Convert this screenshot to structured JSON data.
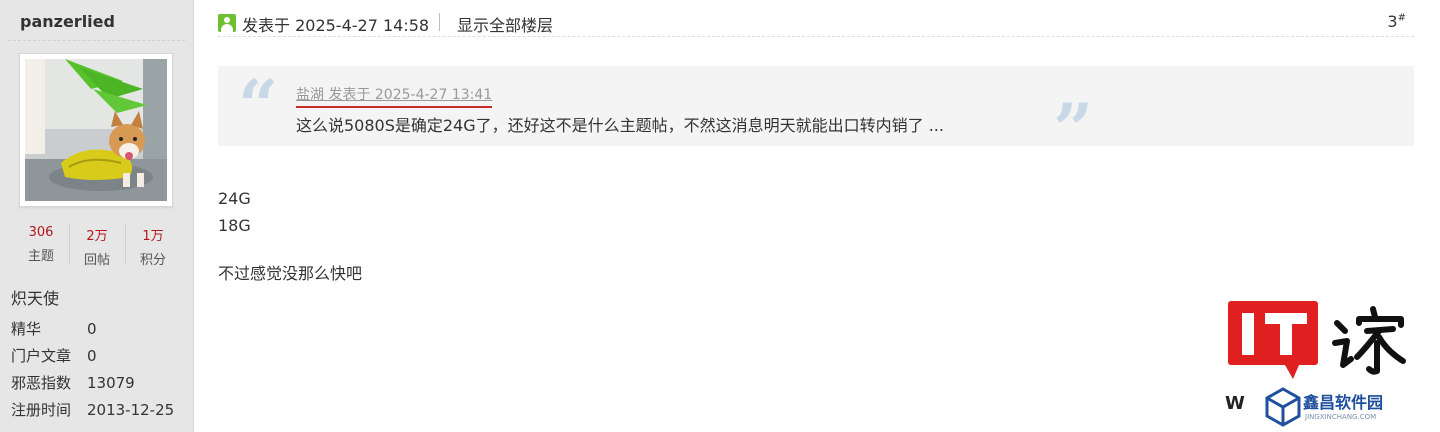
{
  "sidebar": {
    "username": "panzerlied",
    "stats": [
      {
        "value": "306",
        "label": "主题"
      },
      {
        "value": "2万",
        "label": "回帖"
      },
      {
        "value": "1万",
        "label": "积分"
      }
    ],
    "rank": "炽天使",
    "info": [
      {
        "label": "精华",
        "value": "0"
      },
      {
        "label": "门户文章",
        "value": "0"
      },
      {
        "label": "邪恶指数",
        "value": "13079"
      },
      {
        "label": "注册时间",
        "value": "2013-12-25"
      }
    ]
  },
  "post": {
    "posted_at": "发表于 2025-4-27 14:58",
    "show_all": "显示全部楼层",
    "floor": "3",
    "floor_mark": "#",
    "quote": {
      "author_line": "盐湖 发表于 2025-4-27 13:41",
      "text": "这么说5080S是确定24G了，还好这不是什么主题帖，不然这消息明天就能出口转内销了 ..."
    },
    "body": {
      "line1": "24G",
      "line2": "18G",
      "line3": "不过感觉没那么快吧"
    }
  },
  "watermark": {
    "left_letter": "W",
    "brand": "鑫昌软件园",
    "sub": "JINGXINCHANG.COM"
  },
  "colors": {
    "stat_number": "#b2171c",
    "online_icon": "#6fbd31",
    "quote_marks": "#c8d8e8",
    "underline": "#c92a2a",
    "it_logo": "#e02020",
    "brand": "#1f4f9e"
  }
}
